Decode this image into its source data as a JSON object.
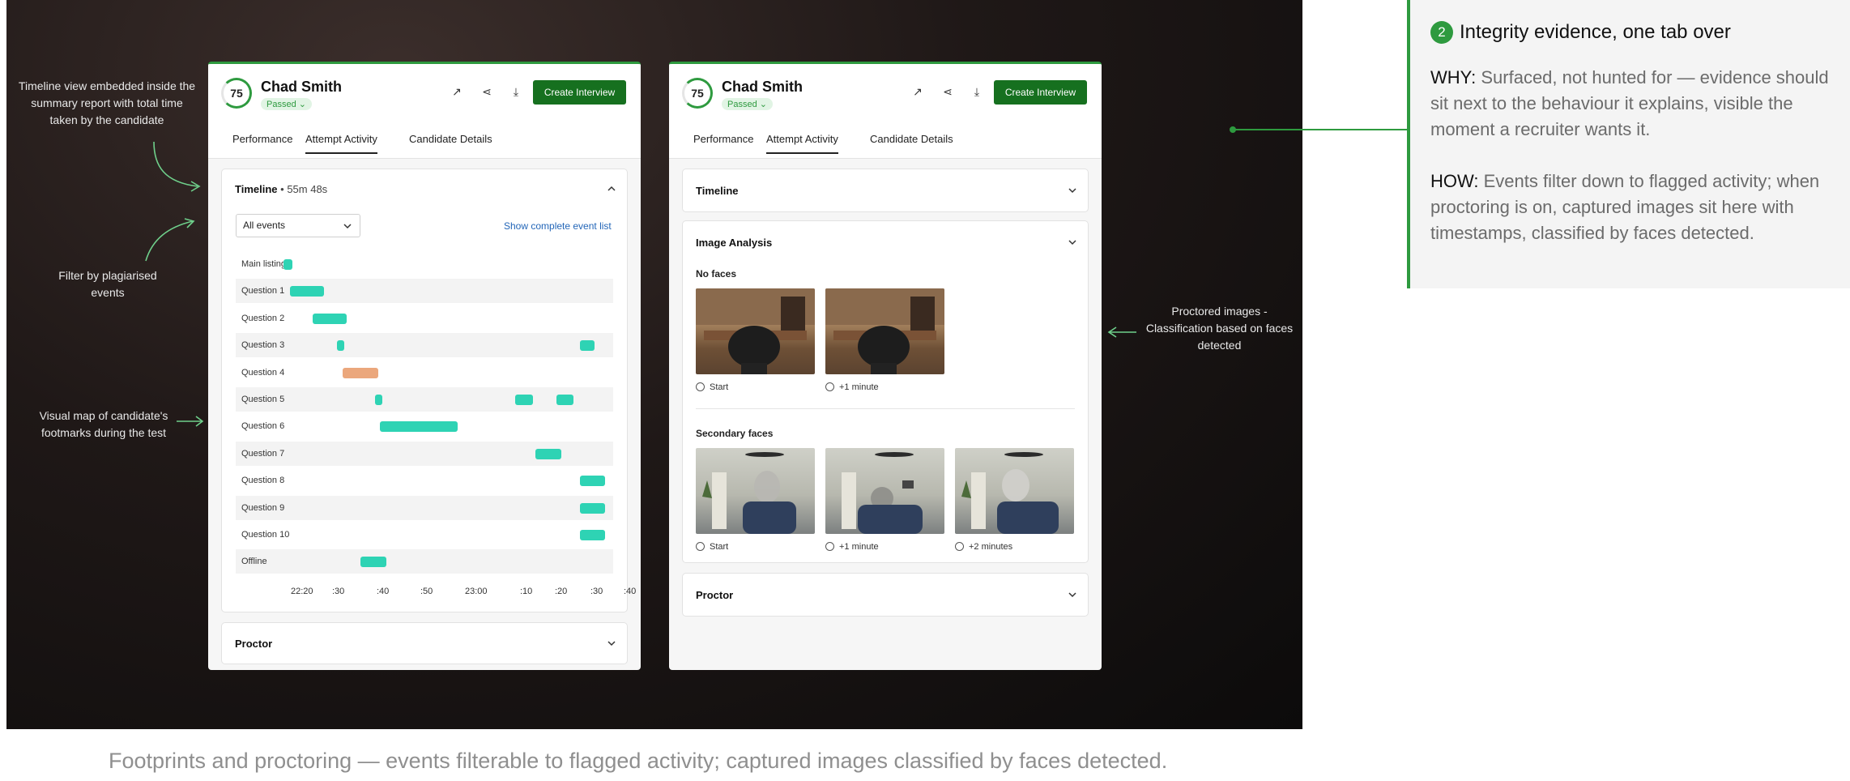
{
  "left_annotations": [
    "Timeline view embedded inside the summary report with total time taken by the candidate",
    "Filter by plagiarised events",
    "Visual map of candidate's footmarks during the test"
  ],
  "right_annotation": "Proctored images - Classification based on faces detected",
  "bottom_caption": "Footprints and proctoring — events filterable to flagged activity; captured images classified by faces detected.",
  "card": {
    "score": "75",
    "name": "Chad Smith",
    "status": "Passed",
    "create_button": "Create Interview",
    "tabs": [
      "Performance",
      "Attempt Activity",
      "Candidate Details"
    ]
  },
  "timeline": {
    "title": "Timeline",
    "duration": "55m 48s",
    "filter_value": "All events",
    "link": "Show complete event list",
    "rows": [
      "Main listing",
      "Question 1",
      "Question 2",
      "Question 3",
      "Question 4",
      "Question 5",
      "Question 6",
      "Question 7",
      "Question 8",
      "Question 9",
      "Question 10",
      "Offline"
    ],
    "ticks": [
      "22:20",
      ":30",
      ":40",
      ":50",
      "23:00",
      ":10",
      ":20",
      ":30",
      ":40"
    ],
    "accent": "#2ed3b4",
    "flagged_color": "#eba77c"
  },
  "proctor_title": "Proctor",
  "image_analysis": {
    "timeline_title": "Timeline",
    "title": "Image Analysis",
    "no_faces_title": "No faces",
    "no_faces_caps": [
      "Start",
      "+1 minute"
    ],
    "secondary_title": "Secondary faces",
    "secondary_caps": [
      "Start",
      "+1 minute",
      "+2 minutes"
    ]
  },
  "right_card": {
    "number": "2",
    "title": "Integrity evidence, one tab over",
    "why_label": "WHY:",
    "why_text": "Surfaced, not hunted for — evidence should sit next to the behaviour it explains, visible the moment a recruiter wants it.",
    "how_label": "HOW:",
    "how_text": "Events filter down to flagged activity; when proctoring is on, captured images sit here with timestamps, classified by faces detected."
  }
}
